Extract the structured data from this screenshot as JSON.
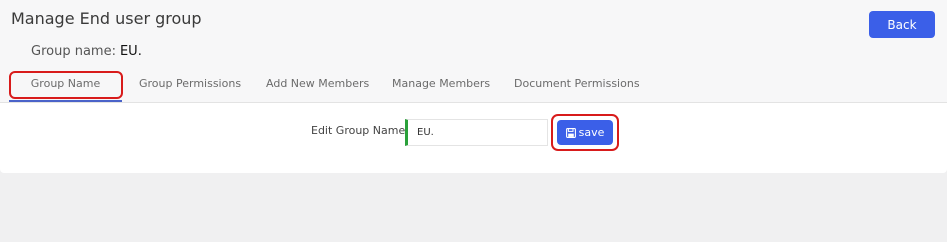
{
  "header": {
    "title": "Manage End user group",
    "back_label": "Back",
    "group_name_label": "Group name:",
    "group_name_value": "EU."
  },
  "tabs": [
    {
      "label": "Group Name",
      "active": true
    },
    {
      "label": "Group Permissions",
      "active": false
    },
    {
      "label": "Add New Members",
      "active": false
    },
    {
      "label": "Manage Members",
      "active": false
    },
    {
      "label": "Document Permissions",
      "active": false
    }
  ],
  "form": {
    "edit_label": "Edit Group Name",
    "group_name_value": "EU.",
    "save_label": "save",
    "save_icon": "floppy-disk-icon"
  },
  "colors": {
    "accent": "#3b5fe8",
    "highlight": "#d81b1b",
    "input_valid": "#2aa13a"
  }
}
